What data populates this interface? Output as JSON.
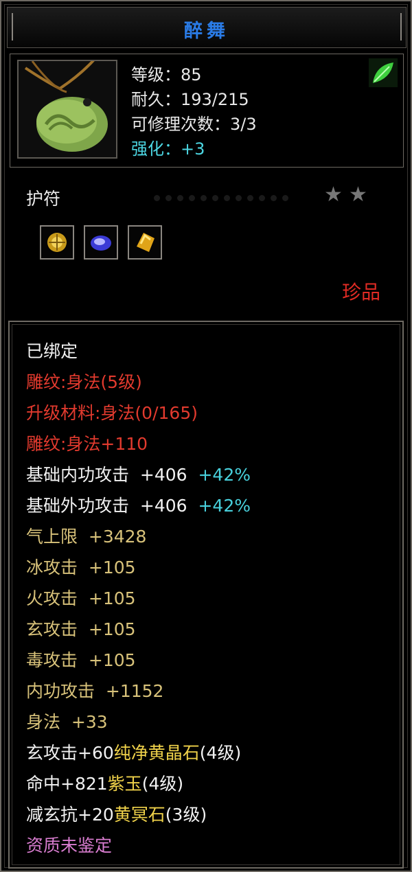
{
  "title": "醉舞",
  "header": {
    "level": "等级：85",
    "durability": "耐久：193/215",
    "repairs": "可修理次数：3/3",
    "enhance_label": "强化：",
    "enhance_value": "+3"
  },
  "middle": {
    "item_type": "护符",
    "rarity": "珍品",
    "stars": 2,
    "gems": [
      "gold-gem-icon",
      "purple-gem-icon",
      "yellow-gem-icon"
    ]
  },
  "attributes": {
    "bound": "已绑定",
    "engrave": "雕纹:身法(5级)",
    "upgrade_material": "升级材料:身法(0/165)",
    "engrave_bonus": "雕纹:身法+110",
    "base_internal": {
      "label": "基础内功攻击  +406",
      "pct": "+42%"
    },
    "base_external": {
      "label": "基础外功攻击  +406",
      "pct": "+42%"
    },
    "qi": "气上限  +3428",
    "ice": "冰攻击  +105",
    "fire": "火攻击  +105",
    "mystic": "玄攻击  +105",
    "poison": "毒攻击  +105",
    "internal": "内功攻击  +1152",
    "agility": "身法  +33",
    "gem1": {
      "stat": "玄攻击+60",
      "name": "纯净黄晶石",
      "level": "(4级)"
    },
    "gem2": {
      "stat": "命中+821",
      "name": "紫玉",
      "level": "(4级)"
    },
    "gem3": {
      "stat": "减玄抗+20",
      "name": "黄冥石",
      "level": "(3级)"
    },
    "aptitude": "资质未鉴定"
  },
  "colors": {
    "title": "#2a7be6",
    "red": "#e23a2e",
    "yellow_stat": "#d8c27a",
    "cyan": "#48d0dc",
    "pink": "#d97dd0"
  }
}
